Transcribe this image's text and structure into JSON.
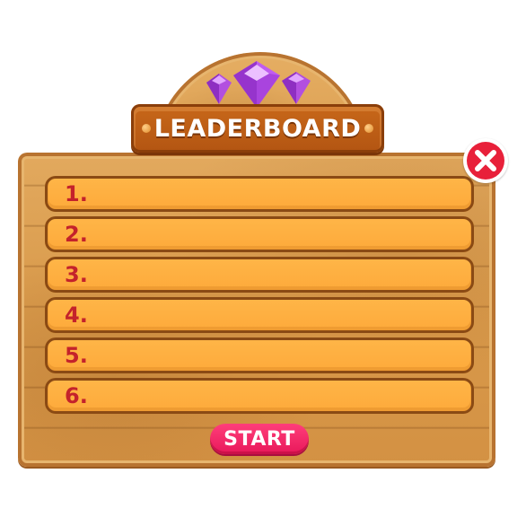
{
  "leaderboard": {
    "title": "LEADERBOARD",
    "ranks": [
      "1.",
      "2.",
      "3.",
      "4.",
      "5.",
      "6."
    ]
  },
  "buttons": {
    "start_label": "START",
    "close_icon": "close-icon"
  },
  "colors": {
    "title_plaque": "#b35512",
    "row_fill": "#fda93a",
    "rank_text": "#c4222b",
    "start_button": "#e8185a",
    "close_button": "#e8203a",
    "gem": "#a63fd8"
  }
}
